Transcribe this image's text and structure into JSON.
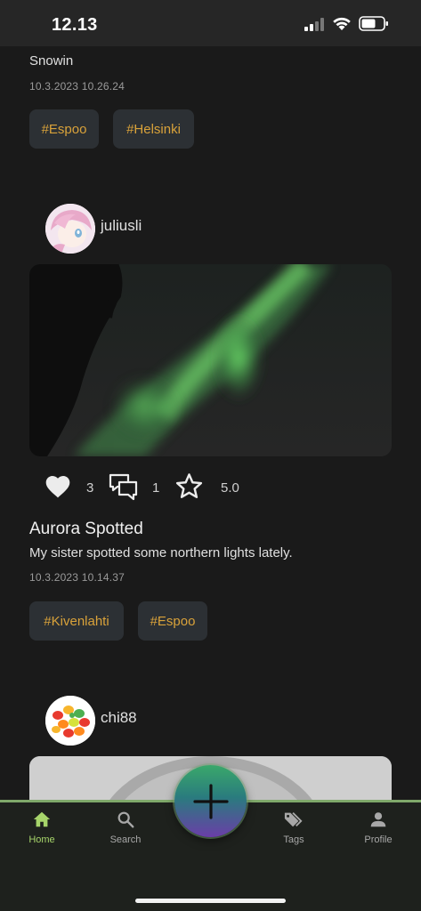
{
  "status_bar": {
    "time": "12.13"
  },
  "posts": [
    {
      "text": "Snowin",
      "date": "10.3.2023 10.26.24",
      "tags": [
        "#Espoo",
        "#Helsinki"
      ]
    },
    {
      "username": "juliusli",
      "likes": "3",
      "comments": "1",
      "rating": "5.0",
      "title": "Aurora Spotted",
      "description": "My sister spotted some northern lights lately.",
      "date": "10.3.2023 10.14.37",
      "tags": [
        "#Kivenlahti",
        "#Espoo"
      ]
    },
    {
      "username": "chi88"
    }
  ],
  "nav": {
    "items": [
      {
        "label": "Home",
        "icon": "home-icon",
        "active": true
      },
      {
        "label": "Search",
        "icon": "search-icon",
        "active": false
      },
      {
        "label": "Tags",
        "icon": "tags-icon",
        "active": false
      },
      {
        "label": "Profile",
        "icon": "profile-icon",
        "active": false
      }
    ],
    "fab_icon": "plus-icon"
  },
  "colors": {
    "background": "#1a1a1a",
    "tag_text": "#d9a23a",
    "tag_bg": "#2c3034",
    "nav_active": "#a6d46a",
    "nav_border": "#7fa86a"
  }
}
